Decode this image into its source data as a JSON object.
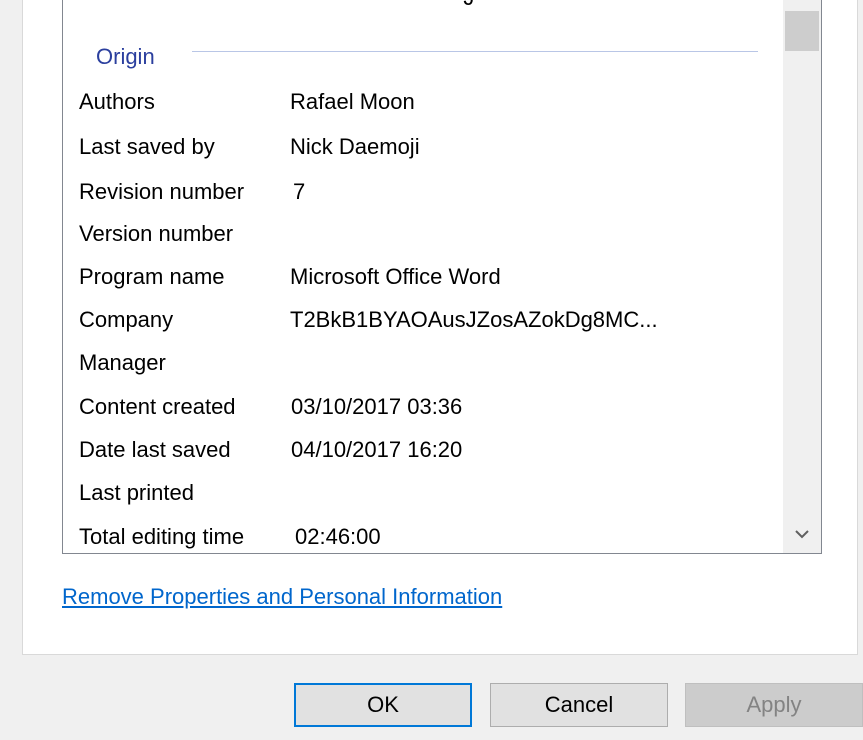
{
  "details": {
    "partial_top_text": "' J",
    "group_title": "Origin",
    "properties": [
      {
        "name": "Authors",
        "value": "Rafael Moon"
      },
      {
        "name": "Last saved by",
        "value": "Nick Daemoji"
      },
      {
        "name": "Revision number",
        "value": "7"
      },
      {
        "name": "Version number",
        "value": ""
      },
      {
        "name": "Program name",
        "value": "Microsoft Office Word"
      },
      {
        "name": "Company",
        "value": "T2BkB1BYAOAusJZosAZokDg8MC..."
      },
      {
        "name": "Manager",
        "value": ""
      },
      {
        "name": "Content created",
        "value": "03/10/2017 03:36"
      },
      {
        "name": "Date last saved",
        "value": "04/10/2017 16:20"
      },
      {
        "name": "Last printed",
        "value": ""
      },
      {
        "name": "Total editing time",
        "value": "02:46:00"
      }
    ]
  },
  "link": {
    "remove_properties": "Remove Properties and Personal Information"
  },
  "buttons": {
    "ok": "OK",
    "cancel": "Cancel",
    "apply": "Apply"
  },
  "icons": {
    "scroll_down": "chevron-down-icon"
  },
  "colors": {
    "group_title": "#2b3f9e",
    "link": "#0066cc",
    "ok_border": "#0078d7",
    "disabled_text": "#838383"
  }
}
